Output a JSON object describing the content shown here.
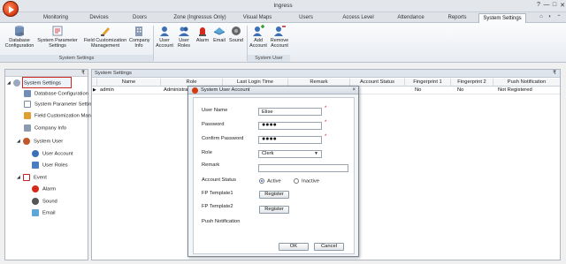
{
  "window": {
    "title": "Ingress",
    "controls": [
      "?",
      "—",
      "□",
      "✕"
    ]
  },
  "menu_tabs": [
    "Monitoring",
    "Devices",
    "Doors",
    "Zone (Ingressus Only)",
    "Visual Maps",
    "Users",
    "Access Level",
    "Attendance",
    "Reports",
    "System Settings"
  ],
  "ribbon": {
    "buttons": [
      {
        "label1": "Database",
        "label2": "Configuration",
        "icon": "database-icon"
      },
      {
        "label1": "System Parameter",
        "label2": "Settings",
        "icon": "parameter-icon"
      },
      {
        "label1": "Field Customization",
        "label2": "Management",
        "icon": "field-customization-icon"
      },
      {
        "label1": "Company",
        "label2": "Info",
        "icon": "company-icon"
      },
      {
        "label1": "User",
        "label2": "Account",
        "icon": "user-account-icon"
      },
      {
        "label1": "User",
        "label2": "Roles",
        "icon": "user-roles-icon"
      },
      {
        "label1": "Alarm",
        "label2": "",
        "icon": "alarm-icon"
      },
      {
        "label1": "Email",
        "label2": "",
        "icon": "email-icon"
      },
      {
        "label1": "Sound",
        "label2": "",
        "icon": "sound-icon"
      },
      {
        "label1": "Add",
        "label2": "Account",
        "icon": "add-account-icon"
      },
      {
        "label1": "Remove",
        "label2": "Account",
        "icon": "remove-account-icon"
      }
    ],
    "groups": [
      "System Settings",
      "System User"
    ]
  },
  "sidebar": {
    "pin": "₹",
    "items": [
      {
        "label": "System Settings",
        "icon": "settings-icon"
      },
      {
        "label": "Database Configuration",
        "icon": "database-icon"
      },
      {
        "label": "System Parameter Settings",
        "icon": "parameter-icon"
      },
      {
        "label": "Field Customization Management",
        "icon": "field-icon"
      },
      {
        "label": "Company Info",
        "icon": "company-icon"
      },
      {
        "label": "System User",
        "icon": "system-user-icon"
      },
      {
        "label": "User Account",
        "icon": "user-account-icon"
      },
      {
        "label": "User Roles",
        "icon": "user-roles-icon"
      },
      {
        "label": "Event",
        "icon": "event-icon"
      },
      {
        "label": "Alarm",
        "icon": "alarm-icon"
      },
      {
        "label": "Sound",
        "icon": "sound-icon"
      },
      {
        "label": "Email",
        "icon": "email-icon"
      }
    ]
  },
  "main": {
    "header": "System Settings",
    "pin": "₹",
    "columns": [
      "Name",
      "Role",
      "Last Login Time",
      "Remark",
      "Account Status",
      "Fingerprint 1",
      "Fingerprint 2",
      "Push Notification"
    ],
    "rows": [
      {
        "name": "admin",
        "role": "Administrat",
        "last_login": "",
        "remark": "",
        "status": "ve",
        "fp1": "No",
        "fp2": "No",
        "push": "Not Registered"
      }
    ]
  },
  "dialog": {
    "title": "System User Account",
    "close": "×",
    "fields": {
      "user_name_label": "User Name",
      "user_name_value": "Elise",
      "password_label": "Password",
      "password_value": "●●●●",
      "confirm_label": "Confirm Password",
      "confirm_value": "●●●●",
      "role_label": "Role",
      "role_value": "Clerk",
      "remark_label": "Remark",
      "remark_value": "",
      "status_label": "Account Status",
      "status_active": "Active",
      "status_inactive": "Inactive",
      "fp1_label": "FP Template1",
      "fp2_label": "FP Template2",
      "register_label": "Register",
      "push_label": "Push Notification",
      "required_mark": "*"
    },
    "ok_label": "OK",
    "cancel_label": "Cancel"
  },
  "colors": {
    "accent_red": "#d0241e",
    "tab_active_bg": "#fafbfc",
    "ribbon_bg": "#eef1f5"
  }
}
